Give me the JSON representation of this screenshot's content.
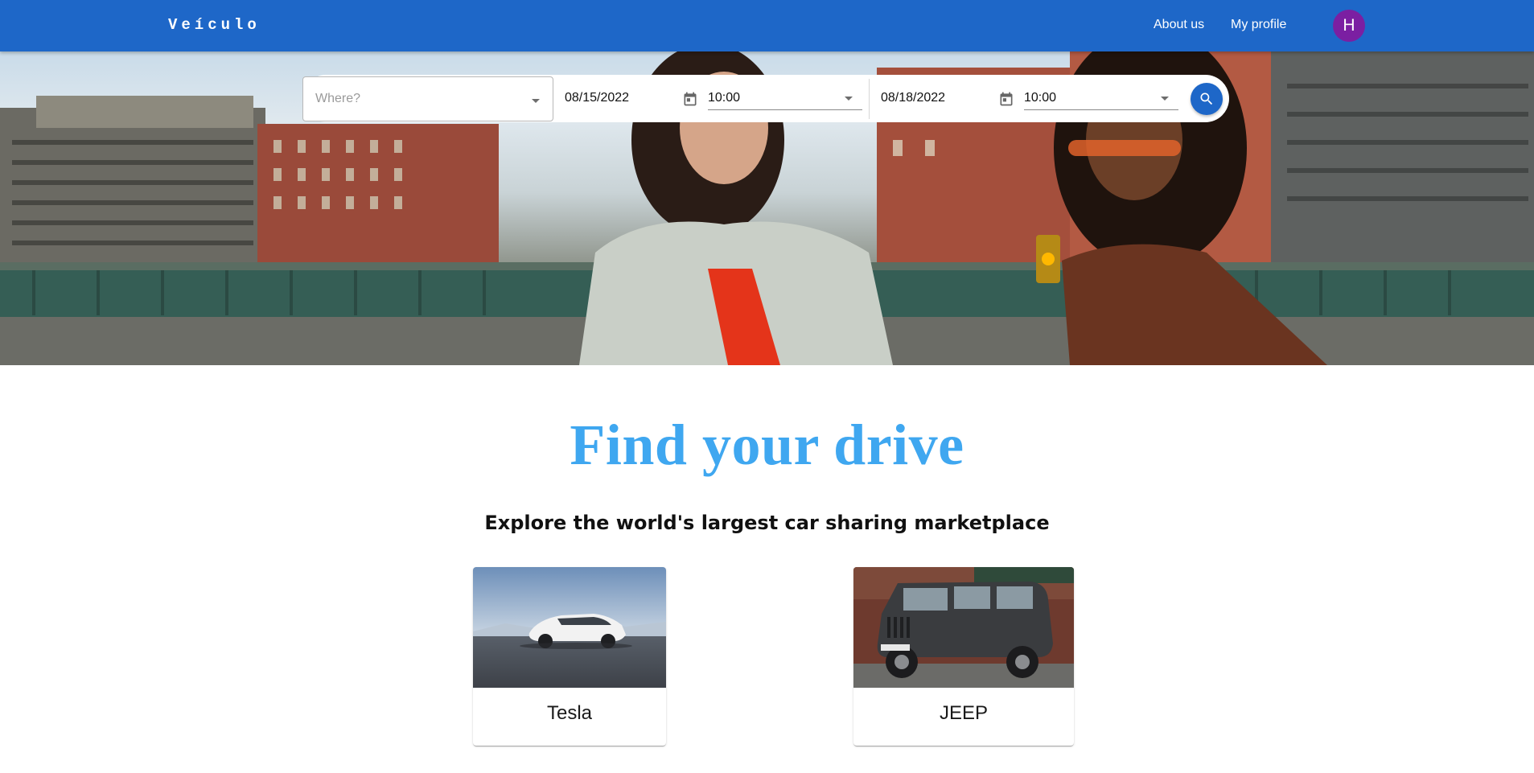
{
  "brand": {
    "name": "Veículo"
  },
  "nav": {
    "about_label": "About us",
    "profile_label": "My profile",
    "avatar_initial": "H",
    "avatar_color": "#7b1fa2"
  },
  "colors": {
    "primary": "#1e67c8",
    "headline": "#3fa7f0"
  },
  "search": {
    "where_placeholder": "Where?",
    "start_date": "08/15/2022",
    "start_time": "10:00",
    "end_date": "08/18/2022",
    "end_time": "10:00",
    "icons": {
      "calendar": "calendar-icon",
      "dropdown": "arrow-drop-down-icon",
      "search": "search-icon"
    }
  },
  "main": {
    "headline": "Find your drive",
    "subheadline": "Explore the world's largest car sharing marketplace",
    "cards": [
      {
        "label": "Tesla"
      },
      {
        "label": "JEEP"
      }
    ]
  }
}
